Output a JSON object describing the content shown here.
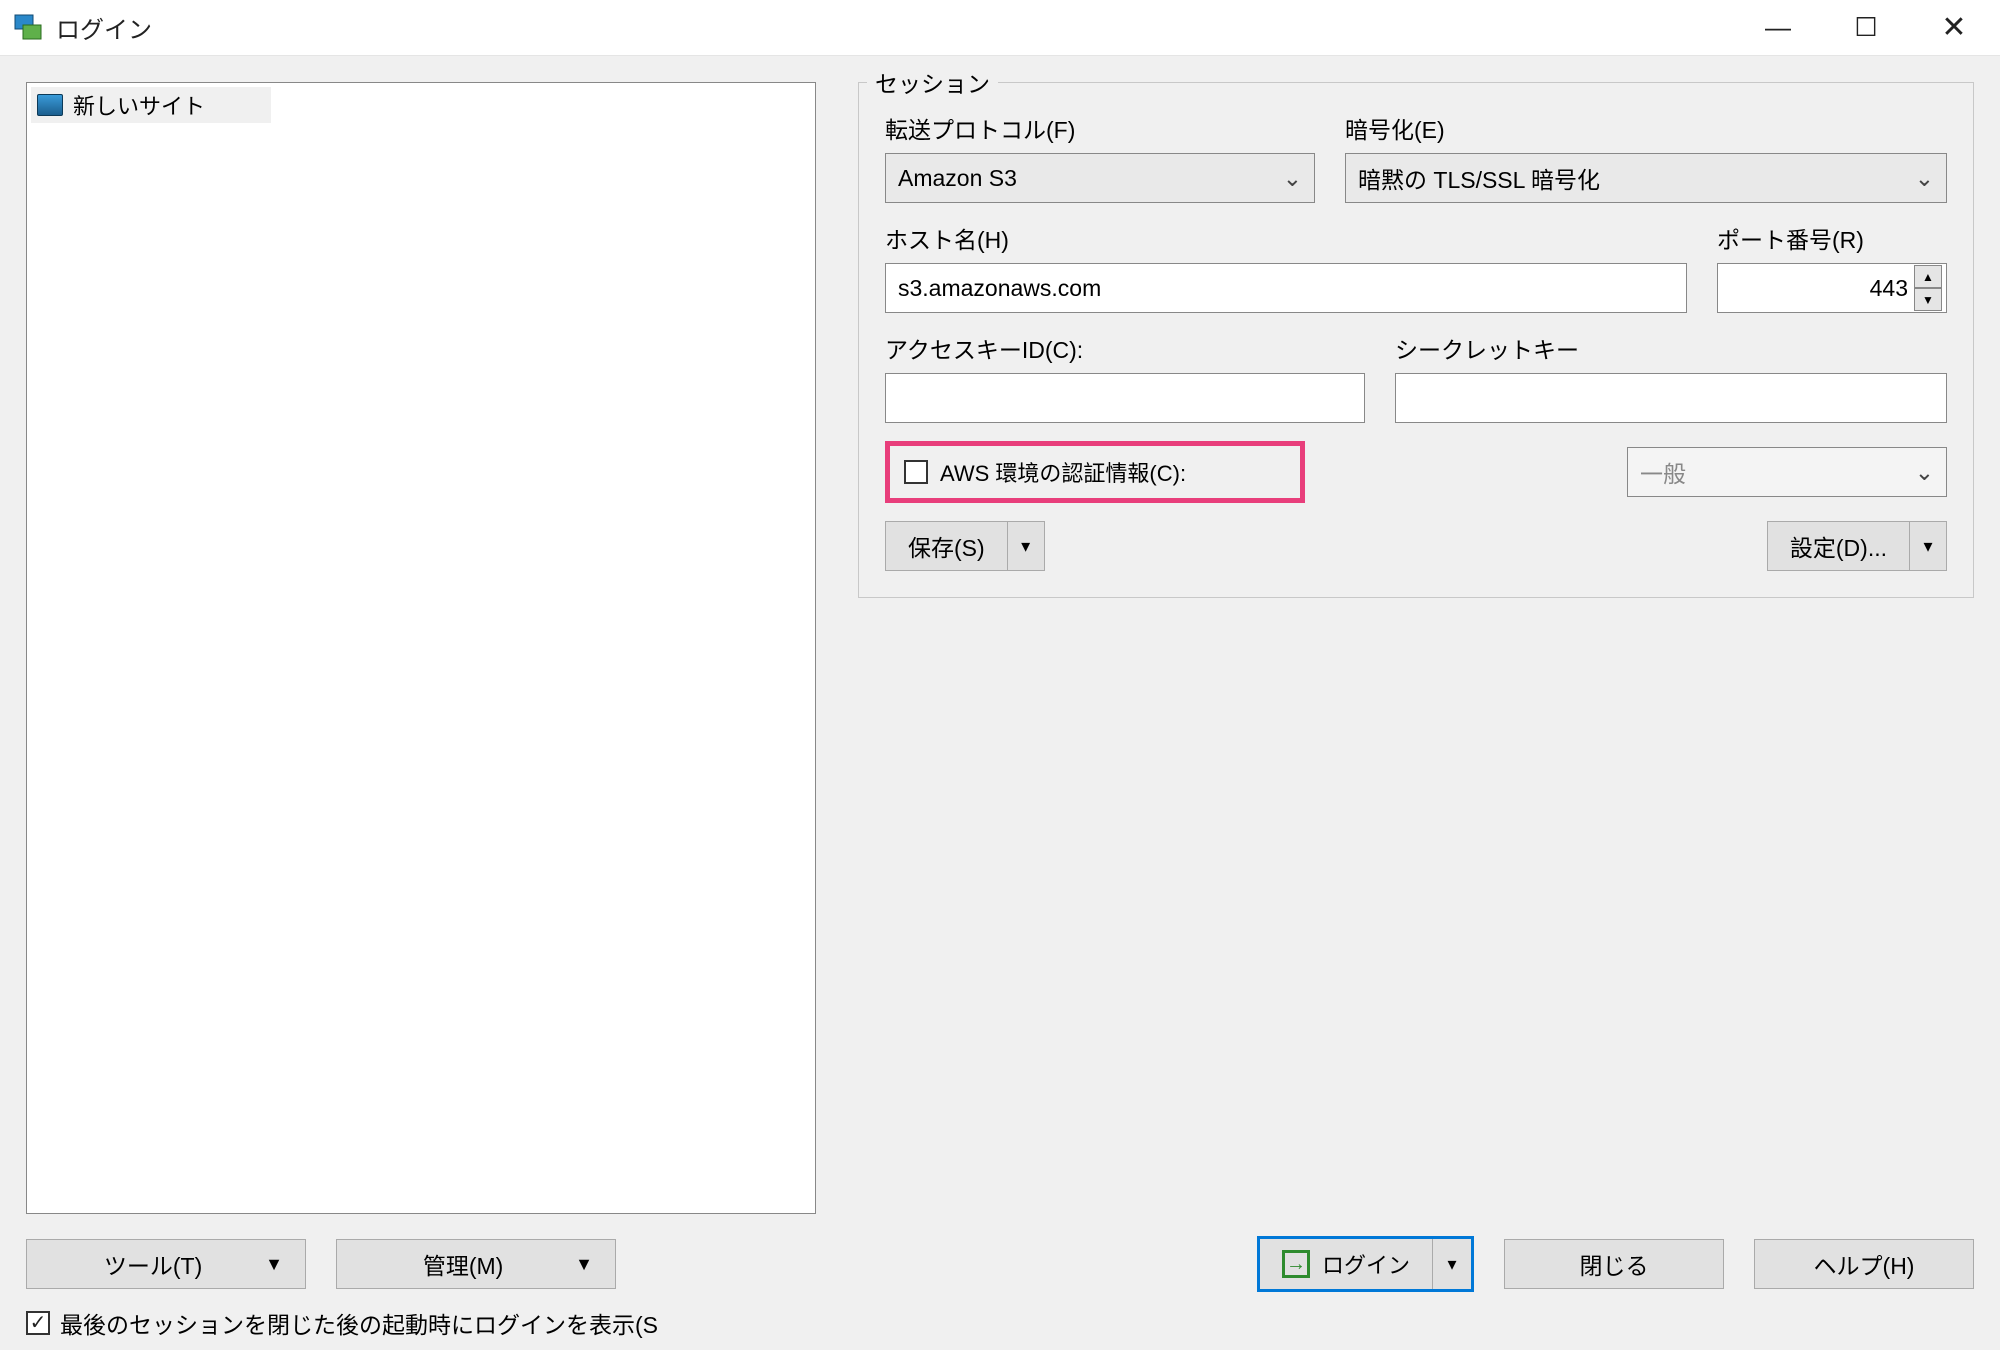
{
  "window": {
    "title": "ログイン"
  },
  "sidebar": {
    "items": [
      {
        "label": "新しいサイト"
      }
    ]
  },
  "session": {
    "group_label": "セッション",
    "protocol_label": "転送プロトコル(F)",
    "protocol_value": "Amazon S3",
    "encryption_label": "暗号化(E)",
    "encryption_value": "暗黙の TLS/SSL 暗号化",
    "host_label": "ホスト名(H)",
    "host_value": "s3.amazonaws.com",
    "port_label": "ポート番号(R)",
    "port_value": "443",
    "access_key_label": "アクセスキーID(C):",
    "access_key_value": "",
    "secret_key_label": "シークレットキー",
    "secret_key_value": "",
    "aws_env_checkbox_label": "AWS 環境の認証情報(C):",
    "aws_env_checked": false,
    "general_combo_value": "一般",
    "save_label": "保存(S)",
    "settings_label": "設定(D)..."
  },
  "toolbar": {
    "tools_label": "ツール(T)",
    "manage_label": "管理(M)",
    "login_label": "ログイン",
    "close_label": "閉じる",
    "help_label": "ヘルプ(H)"
  },
  "footer": {
    "show_login_label": "最後のセッションを閉じた後の起動時にログインを表示(S",
    "show_login_checked": true
  }
}
